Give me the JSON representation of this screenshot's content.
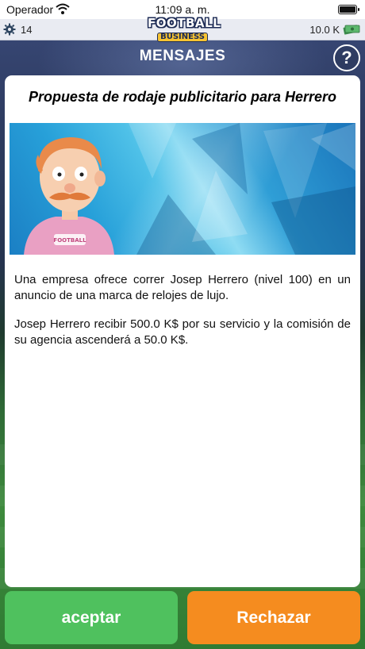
{
  "status_bar": {
    "carrier": "Operador",
    "time": "11:09 a. m."
  },
  "top_bar": {
    "level": "14",
    "money": "10.0 K",
    "icons": [
      "gear-icon",
      "cash-icon"
    ]
  },
  "logo": {
    "line1": "FOOTBALL",
    "line2": "BUSINESS"
  },
  "header": {
    "title": "MENSAJES",
    "help_label": "?"
  },
  "message": {
    "headline": "Propuesta de rodaje publicitario para Herrero",
    "banner_shirt_text": "FOOTBALL",
    "paragraphs": [
      "Una empresa ofrece correr Josep Herrero (nivel 100) en un anuncio de una marca de relojes de lujo.",
      "Josep Herrero recibir 500.0 K$ por su servicio y la comisión de su agencia ascenderá a 50.0 K$."
    ]
  },
  "actions": {
    "accept_label": "aceptar",
    "reject_label": "Rechazar"
  },
  "colors": {
    "accept": "#4fc15e",
    "reject": "#f58c1f"
  }
}
